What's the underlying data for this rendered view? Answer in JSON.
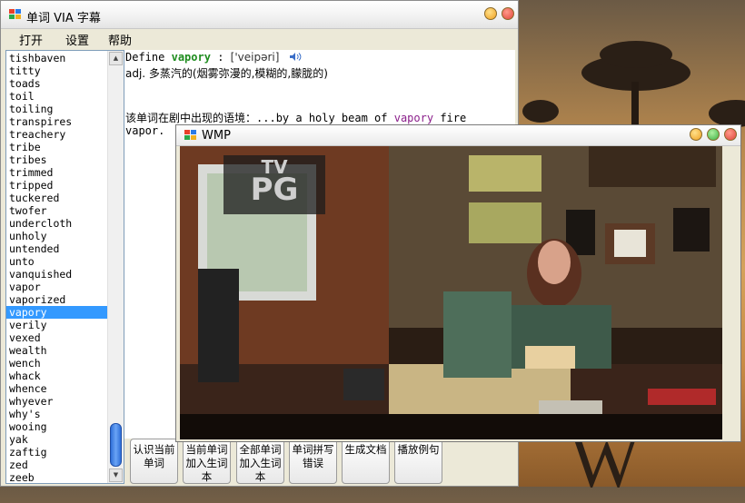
{
  "desktop": {
    "logo_letter": "W"
  },
  "main_window": {
    "title": "单词 VIA 字幕",
    "menu": [
      "打开",
      "设置",
      "帮助"
    ],
    "word_list": {
      "items": [
        "tishbaven",
        "titty",
        "toads",
        "toil",
        "toiling",
        "transpires",
        "treachery",
        "tribe",
        "tribes",
        "trimmed",
        "tripped",
        "tuckered",
        "twofer",
        "undercloth",
        "unholy",
        "untended",
        "unto",
        "vanquished",
        "vapor",
        "vaporized",
        "vapory",
        "verily",
        "vexed",
        "wealth",
        "wench",
        "whack",
        "whence",
        "whyever",
        "why's",
        "wooing",
        "yak",
        "zaftig",
        "zed",
        "zeeb"
      ],
      "selected": "vapory"
    },
    "definition": {
      "define_prefix": "Define",
      "word": "vapory",
      "colon": ":",
      "phonetic": "['veipəri]",
      "meaning": "adj. 多蒸汽的(烟雾弥漫的,模糊的,朦胧的)",
      "context_label": "该单词在剧中出现的语境：",
      "context_before": "...by a holy beam of ",
      "context_word": "vapory",
      "context_after": " fire",
      "context_line2": "vapor."
    },
    "buttons": [
      "认识当前单词",
      "当前单词加入生词本",
      "全部单词加入生词本",
      "单词拼写错误",
      "生成文档",
      "播放例句"
    ]
  },
  "wmp_window": {
    "title": "WMP",
    "rating_line1": "TV",
    "rating_line2": "PG"
  },
  "colors": {
    "selection": "#3399ff",
    "keyword": "#1e8c1e",
    "highlight": "#8a1e8a",
    "close_btn": "#e0443a",
    "min_btn": "#f0a020",
    "max_btn": "#3cb043"
  }
}
